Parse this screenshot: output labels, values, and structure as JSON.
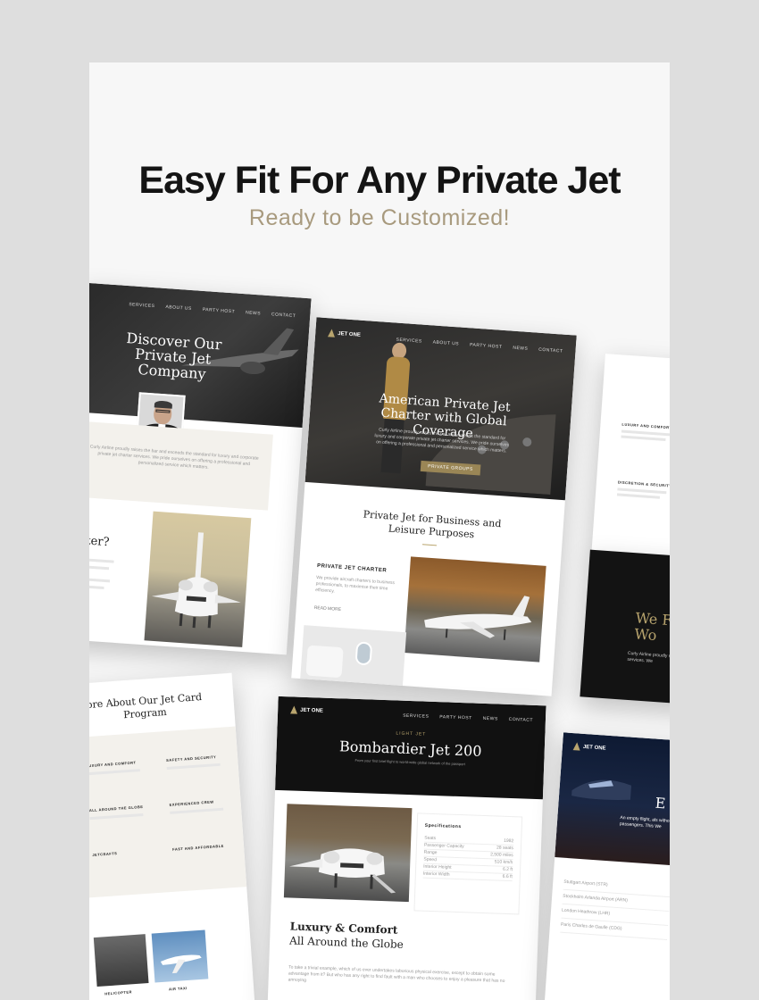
{
  "hero": {
    "headline": "Easy Fit For Any Private Jet",
    "subheadline": "Ready to be Customized!"
  },
  "colors": {
    "accent_gold": "#a89a7e",
    "dark": "#141414",
    "card_bg": "#f7f7f7"
  },
  "shot_company": {
    "nav": [
      "SERVICES",
      "ABOUT US",
      "PARTY HOST",
      "NEWS",
      "CONTACT"
    ],
    "title": "Discover Our Private Jet Company",
    "body": "Curly Airline proudly raises the bar and exceeds the standard for luxury and corporate private jet charter services. We pride ourselves on offering a professional and personalized service which matters.",
    "side_heading": "a harter?"
  },
  "shot_home": {
    "logo": "JET ONE",
    "nav": [
      "SERVICES",
      "ABOUT US",
      "PARTY HOST",
      "NEWS",
      "CONTACT"
    ],
    "hero_title": "American Private Jet Charter with Global Coverage",
    "hero_body": "Curly Airline proudly raises the bar and exceeds the standard for luxury and corporate private jet charter services. We pride ourselves on offering a professional and personalized service which matters.",
    "hero_button": "PRIVATE GROUPS",
    "section_title": "Private Jet for Business and Leisure Purposes",
    "feature_label": "PRIVATE JET CHARTER",
    "feature_body": "We provide aircraft charters to business professionals, to maximise their time efficiency.",
    "feature_link": "READ MORE"
  },
  "shot_right_top": {
    "items": [
      "LUXURY AND COMFORT",
      "DISCRETION & SECURITY"
    ],
    "dark_title": "We Fl Wo",
    "dark_body": "Curly Airline proudly ra charter services. We"
  },
  "shot_jetcard": {
    "title": "ore About Our Jet Card Program",
    "features": [
      "LUXURY AND COMFORT",
      "SAFETY AND SECURITY",
      "ALL AROUND THE GLOBE",
      "EXPERIENCED CREW",
      "JETCRAFTS",
      "FAST AND AFFORDABLE"
    ],
    "captions": [
      "HELICOPTER",
      "AIR TAXI"
    ]
  },
  "shot_product": {
    "logo": "JET ONE",
    "nav": [
      "SERVICES",
      "PARTY HOST",
      "NEWS",
      "CONTACT"
    ],
    "kicker": "LIGHT JET",
    "title": "Bombardier Jet 200",
    "subtitle": "From your first brief flight to world-wide global network of the passport",
    "spec_heading": "Specifications",
    "specs": [
      {
        "k": "Seats",
        "v": "1982"
      },
      {
        "k": "Passenger Capacity",
        "v": "28 seats"
      },
      {
        "k": "Range",
        "v": "2,500 miles"
      },
      {
        "k": "Speed",
        "v": "510 km/h"
      },
      {
        "k": "Interior Height",
        "v": "6.2 ft"
      },
      {
        "k": "Interior Width",
        "v": "6.6 ft"
      }
    ],
    "copy_title_1": "Luxury & Comfort",
    "copy_title_2": "All Around the Globe",
    "copy_body": "To take a trivial example, which of us ever undertakes laborious physical exercise, except to obtain some advantage from it? But who has any right to find fault with a man who chooses to enjoy a pleasure that has no annoying"
  },
  "shot_right_bottom": {
    "logo": "JET ONE",
    "hero_letter": "E",
    "hero_body": "An empty flight, als without passengers. This We",
    "rows": [
      "Stuttgart Airport (STR)",
      "Stockholm Arlanda Airport (ARN)",
      "London Heathrow (LHR)",
      "Paris Charles de Gaulle (CDG)"
    ]
  }
}
